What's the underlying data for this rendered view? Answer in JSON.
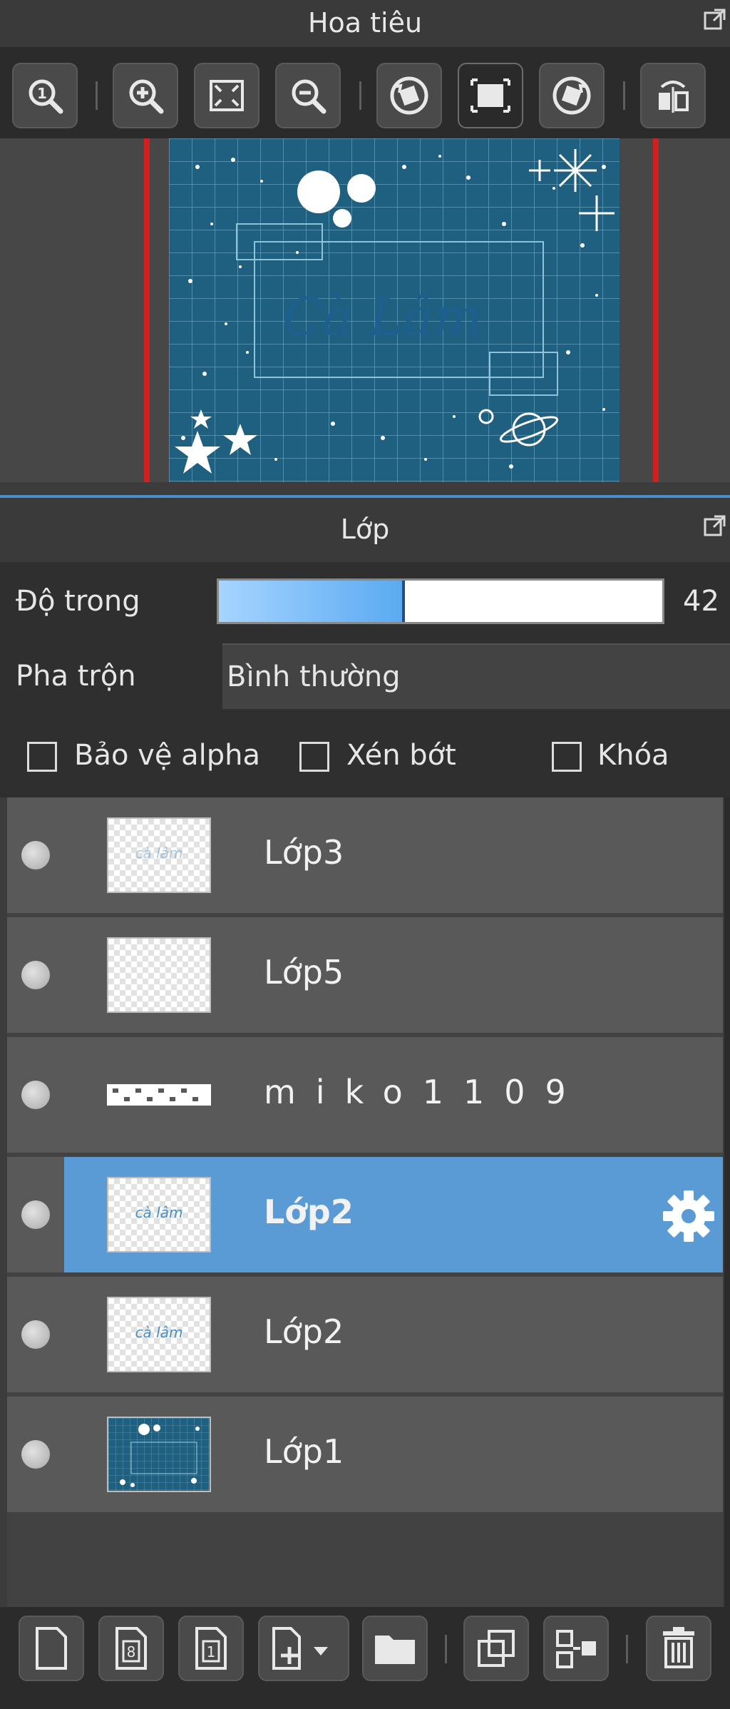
{
  "navigator": {
    "title": "Hoa tiêu",
    "popout_icon": "popout-icon",
    "toolbar": [
      {
        "name": "zoom-actual-icon"
      },
      {
        "name": "zoom-in-icon"
      },
      {
        "name": "fit-screen-icon"
      },
      {
        "name": "zoom-out-icon"
      },
      {
        "name": "rotate-left-icon"
      },
      {
        "name": "reset-view-icon"
      },
      {
        "name": "rotate-right-icon"
      },
      {
        "name": "flip-horizontal-icon"
      }
    ],
    "preview": {
      "text": "Cà Lâm"
    }
  },
  "layers_panel": {
    "title": "Lớp",
    "opacity_label": "Độ trong",
    "opacity_value": "42",
    "opacity_fraction": 0.42,
    "blend_label": "Pha trộn",
    "blend_value": "Bình thường",
    "checkboxes": [
      {
        "label": "Bảo vệ alpha",
        "checked": false
      },
      {
        "label": "Xén bớt",
        "checked": false
      },
      {
        "label": "Khóa",
        "checked": false
      }
    ],
    "layers": [
      {
        "name": "Lớp3",
        "selected": false,
        "thumb": "faint",
        "thumb_text": "cà lâm"
      },
      {
        "name": "Lớp5",
        "selected": false,
        "thumb": "empty",
        "thumb_text": ""
      },
      {
        "name": "miko1109",
        "selected": false,
        "thumb": "white-text",
        "thumb_text": ""
      },
      {
        "name": "Lớp2",
        "selected": true,
        "thumb": "text",
        "thumb_text": "cà lâm"
      },
      {
        "name": "Lớp2",
        "selected": false,
        "thumb": "text",
        "thumb_text": "cà lâm"
      },
      {
        "name": "Lớp1",
        "selected": false,
        "thumb": "blue-grid",
        "thumb_text": ""
      }
    ]
  },
  "bottom_toolbar": [
    {
      "name": "new-layer-icon"
    },
    {
      "name": "new-8bit-layer-icon"
    },
    {
      "name": "new-1bit-layer-icon"
    },
    {
      "name": "add-layer-menu-icon"
    },
    {
      "name": "folder-icon"
    },
    {
      "name": "duplicate-layer-icon"
    },
    {
      "name": "merge-down-icon"
    },
    {
      "name": "delete-layer-icon"
    }
  ],
  "colors": {
    "selected_row": "#5a9bd5",
    "accent_line": "#4b8fc8",
    "canvas_border": "#d21f1f",
    "canvas_bg": "#1f5f80"
  }
}
